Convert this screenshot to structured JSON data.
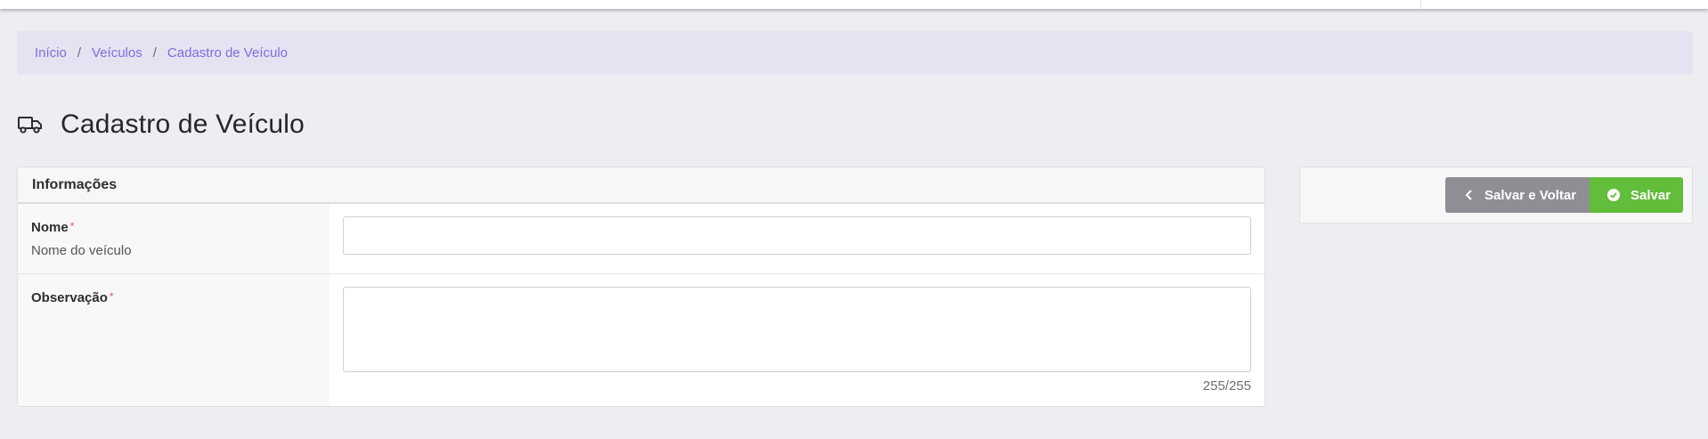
{
  "breadcrumb": {
    "items": [
      {
        "label": "Início"
      },
      {
        "label": "Veículos"
      },
      {
        "label": "Cadastro de Veículo"
      }
    ],
    "separator": "/"
  },
  "page": {
    "title": "Cadastro de Veículo",
    "icon": "truck-icon"
  },
  "form": {
    "section_title": "Informações",
    "nome": {
      "label": "Nome",
      "required_mark": "*",
      "hint": "Nome do veículo",
      "value": ""
    },
    "observacao": {
      "label": "Observação",
      "required_mark": "*",
      "value": "",
      "counter": "255/255"
    }
  },
  "actions": {
    "back_label": "Salvar e Voltar",
    "back_icon": "chevron-left-icon",
    "save_label": "Salvar",
    "save_icon": "check-circle-icon"
  },
  "colors": {
    "accent": "#7b6ee0",
    "save": "#62bd3b",
    "secondary": "#8e8f95",
    "required": "#e0574f"
  }
}
